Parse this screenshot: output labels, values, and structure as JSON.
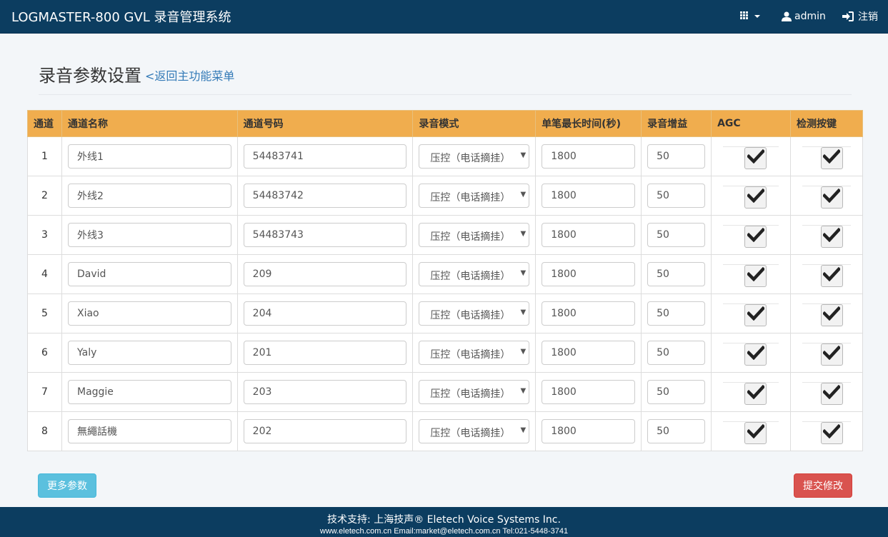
{
  "header": {
    "brand": "LOGMASTER-800 GVL 录音管理系统",
    "user": "admin",
    "logout": "注销"
  },
  "page": {
    "title": "录音参数设置",
    "back_link": "<返回主功能菜单"
  },
  "table": {
    "columns": [
      "通道",
      "通道名称",
      "通道号码",
      "录音模式",
      "单笔最长时间(秒)",
      "录音增益",
      "AGC",
      "检测按键"
    ],
    "rows": [
      {
        "channel": "1",
        "name": "外线1",
        "number": "54483741",
        "mode": "压控（电话摘挂）",
        "max_time": "1800",
        "gain": "50",
        "agc": true,
        "detect_key": true
      },
      {
        "channel": "2",
        "name": "外线2",
        "number": "54483742",
        "mode": "压控（电话摘挂）",
        "max_time": "1800",
        "gain": "50",
        "agc": true,
        "detect_key": true
      },
      {
        "channel": "3",
        "name": "外线3",
        "number": "54483743",
        "mode": "压控（电话摘挂）",
        "max_time": "1800",
        "gain": "50",
        "agc": true,
        "detect_key": true
      },
      {
        "channel": "4",
        "name": "David",
        "number": "209",
        "mode": "压控（电话摘挂）",
        "max_time": "1800",
        "gain": "50",
        "agc": true,
        "detect_key": true
      },
      {
        "channel": "5",
        "name": "Xiao",
        "number": "204",
        "mode": "压控（电话摘挂）",
        "max_time": "1800",
        "gain": "50",
        "agc": true,
        "detect_key": true
      },
      {
        "channel": "6",
        "name": "Yaly",
        "number": "201",
        "mode": "压控（电话摘挂）",
        "max_time": "1800",
        "gain": "50",
        "agc": true,
        "detect_key": true
      },
      {
        "channel": "7",
        "name": "Maggie",
        "number": "203",
        "mode": "压控（电话摘挂）",
        "max_time": "1800",
        "gain": "50",
        "agc": true,
        "detect_key": true
      },
      {
        "channel": "8",
        "name": "無繩話機",
        "number": "202",
        "mode": "压控（电话摘挂）",
        "max_time": "1800",
        "gain": "50",
        "agc": true,
        "detect_key": true
      }
    ]
  },
  "buttons": {
    "more": "更多参数",
    "submit": "提交修改"
  },
  "footer": {
    "line1": "技术支持: 上海技声® Eletech Voice Systems Inc.",
    "line2": "www.eletech.com.cn Email:market@eletech.com.cn Tel:021-5448-3741"
  },
  "colors": {
    "navbar": "#0c3d60",
    "table_header": "#f0ad4e",
    "button_info": "#5bc0de",
    "button_danger": "#d9534f",
    "link": "#337ab7"
  },
  "icons": {
    "apps": "grid-icon",
    "user": "user-icon",
    "logout": "logout-icon",
    "dropdown": "caret-down-icon",
    "checkbox": "checkmark-icon"
  }
}
